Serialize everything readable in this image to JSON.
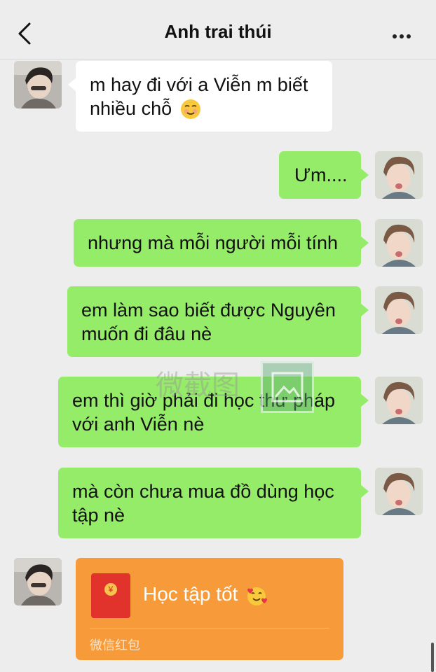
{
  "header": {
    "title": "Anh trai thúi",
    "back_icon": "chevron-left-icon",
    "more_icon": "more-horizontal-icon"
  },
  "messages": [
    {
      "side": "left",
      "text": "m hay đi với a Viễn m biết nhiều chỗ",
      "emoji": "smiling-face-icon"
    },
    {
      "side": "right",
      "text": "Ưm...."
    },
    {
      "side": "right",
      "text": "nhưng mà mỗi người mỗi tính"
    },
    {
      "side": "right",
      "text": "em làm sao biết được Nguyên muốn đi đâu nè"
    },
    {
      "side": "right",
      "text": "em thì giờ phải đi học thư pháp với anh Viễn nè"
    },
    {
      "side": "right",
      "text": "mà còn chưa mua đồ dùng học tập nè"
    }
  ],
  "red_packet": {
    "title": "Học tập tốt",
    "emoji": "smiling-face-with-hearts-icon",
    "footer": "微信红包",
    "coin_symbol": "¥"
  },
  "watermark": "微截图",
  "colors": {
    "background": "#ededed",
    "green_bubble": "#95ec69",
    "white_bubble": "#ffffff",
    "red_packet": "#f79b3a"
  }
}
